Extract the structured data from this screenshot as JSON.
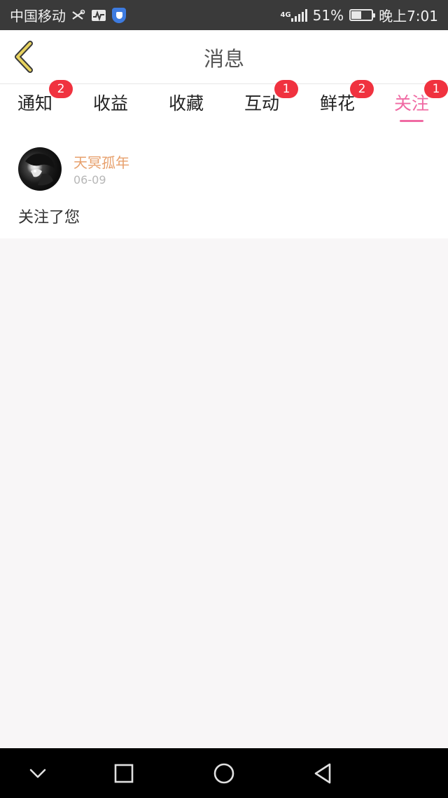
{
  "status_bar": {
    "carrier": "中国移动",
    "network": "4G",
    "battery_percent": "51%",
    "battery_level": 0.51,
    "time": "晚上7:01"
  },
  "header": {
    "title": "消息",
    "back_icon": "chevron-left-icon"
  },
  "tabs": [
    {
      "label": "通知",
      "badge": "2",
      "active": false
    },
    {
      "label": "收益",
      "badge": "",
      "active": false
    },
    {
      "label": "收藏",
      "badge": "",
      "active": false
    },
    {
      "label": "互动",
      "badge": "1",
      "active": false
    },
    {
      "label": "鲜花",
      "badge": "2",
      "active": false
    },
    {
      "label": "关注",
      "badge": "1",
      "active": true
    }
  ],
  "messages": [
    {
      "username": "天冥孤年",
      "date": "06-09",
      "text": "关注了您"
    }
  ],
  "colors": {
    "accent": "#f06aa3",
    "badge": "#f0323f",
    "username": "#e7a06c",
    "back_icon": "#e8d35f"
  },
  "navbar": {
    "icons": [
      "chevron-down-icon",
      "square-icon",
      "circle-icon",
      "triangle-back-icon"
    ]
  }
}
